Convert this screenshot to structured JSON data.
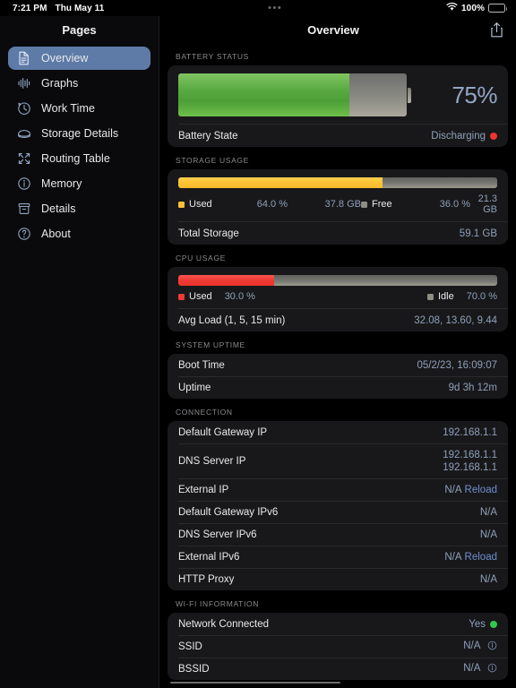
{
  "status_bar": {
    "time": "7:21 PM",
    "date": "Thu May 11",
    "menu_dots": "•••",
    "battery_percent": "100%",
    "wifi_icon": "wifi-icon",
    "battery_icon": "battery-full-icon"
  },
  "sidebar": {
    "title": "Pages",
    "items": [
      {
        "label": "Overview",
        "icon": "document-icon",
        "active": true
      },
      {
        "label": "Graphs",
        "icon": "waveform-icon",
        "active": false
      },
      {
        "label": "Work Time",
        "icon": "clock-arrow-icon",
        "active": false
      },
      {
        "label": "Storage Details",
        "icon": "disk-drive-icon",
        "active": false
      },
      {
        "label": "Routing Table",
        "icon": "routing-arrows-icon",
        "active": false
      },
      {
        "label": "Memory",
        "icon": "info-circle-icon",
        "active": false
      },
      {
        "label": "Details",
        "icon": "archive-box-icon",
        "active": false
      },
      {
        "label": "About",
        "icon": "question-circle-icon",
        "active": false
      }
    ]
  },
  "header": {
    "title": "Overview",
    "share_icon": "share-icon"
  },
  "battery": {
    "section_title": "Battery Status",
    "percent_label": "75%",
    "percent_value": 75,
    "state_label": "Battery State",
    "state_value": "Discharging",
    "state_dot": "red-status-dot"
  },
  "storage": {
    "section_title": "Storage Usage",
    "used_percent": 64.0,
    "used_label": "Used",
    "used_pct_text": "64.0 %",
    "used_size_text": "37.8 GB",
    "free_label": "Free",
    "free_pct_text": "36.0 %",
    "free_size_text": "21.3 GB",
    "total_label": "Total Storage",
    "total_value": "59.1 GB"
  },
  "cpu": {
    "section_title": "CPU Usage",
    "used_percent": 30.0,
    "used_label": "Used",
    "used_pct_text": "30.0 %",
    "idle_label": "Idle",
    "idle_pct_text": "70.0 %",
    "avg_load_label": "Avg Load (1, 5, 15 min)",
    "avg_load_value": "32.08, 13.60, 9.44"
  },
  "uptime": {
    "section_title": "System Uptime",
    "rows": [
      {
        "label": "Boot Time",
        "value": "05/2/23, 16:09:07"
      },
      {
        "label": "Uptime",
        "value": "9d 3h 12m"
      }
    ]
  },
  "connection": {
    "section_title": "Connection",
    "gateway_label": "Default Gateway IP",
    "gateway_value": "192.168.1.1",
    "dns_label": "DNS Server IP",
    "dns_value_1": "192.168.1.1",
    "dns_value_2": "192.168.1.1",
    "external_label": "External IP",
    "external_value": "N/A",
    "external_reload": "Reload",
    "gateway6_label": "Default Gateway IPv6",
    "gateway6_value": "N/A",
    "dns6_label": "DNS Server IPv6",
    "dns6_value": "N/A",
    "external6_label": "External IPv6",
    "external6_value": "N/A",
    "external6_reload": "Reload",
    "proxy_label": "HTTP Proxy",
    "proxy_value": "N/A"
  },
  "wifi": {
    "section_title": "Wi-Fi Information",
    "connected_label": "Network Connected",
    "connected_value": "Yes",
    "connected_dot": "green-status-dot",
    "ssid_label": "SSID",
    "ssid_value": "N/A",
    "bssid_label": "BSSID",
    "bssid_value": "N/A",
    "info_icon": "info-circle-icon"
  },
  "colors": {
    "accent_blue": "#6f8fd0",
    "value_blue": "#8fa0bb",
    "battery_green": "#57a83f",
    "storage_yellow": "#f9c033",
    "cpu_red": "#ef3a33",
    "status_red": "#f0342c",
    "status_green": "#34c84a",
    "sidebar_selected": "#5d7ba6",
    "card_bg": "#18181a"
  }
}
